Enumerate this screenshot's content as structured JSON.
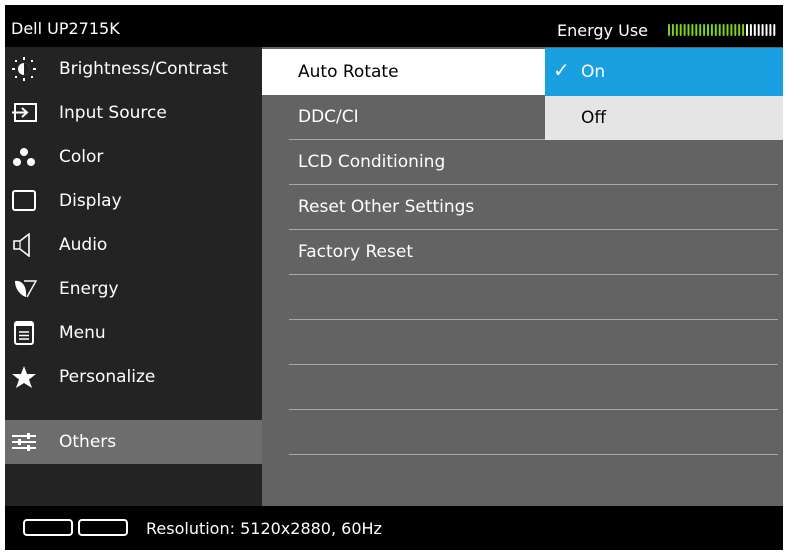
{
  "header": {
    "title": "Dell UP2715K",
    "energy_label": "Energy Use",
    "energy_level": 0.7
  },
  "sidebar": {
    "items": [
      {
        "label": "Brightness/Contrast",
        "icon": "sun-icon"
      },
      {
        "label": "Input Source",
        "icon": "input-arrow-icon"
      },
      {
        "label": "Color",
        "icon": "color-dots-icon"
      },
      {
        "label": "Display",
        "icon": "monitor-icon"
      },
      {
        "label": "Audio",
        "icon": "speaker-icon"
      },
      {
        "label": "Energy",
        "icon": "leaf-icon"
      },
      {
        "label": "Menu",
        "icon": "menu-icon"
      },
      {
        "label": "Personalize",
        "icon": "star-icon"
      },
      {
        "label": "Others",
        "icon": "sliders-icon",
        "active": true
      }
    ]
  },
  "panel": {
    "items": [
      "Auto Rotate",
      "DDC/CI",
      "LCD Conditioning",
      "Reset Other Settings",
      "Factory Reset",
      "",
      "",
      "",
      "",
      ""
    ],
    "selected": "Auto Rotate"
  },
  "dropdown": {
    "options": [
      "On",
      "Off"
    ],
    "selected": "On",
    "check_glyph": "✓"
  },
  "status": {
    "text": "Resolution: 5120x2880, 60Hz"
  },
  "colors": {
    "highlight": "#1a9fe0",
    "sidebar_bg": "#232323",
    "panel_bg": "#636363",
    "active_item_bg": "#6d6d6d",
    "meter_on": "#7dd31a"
  }
}
